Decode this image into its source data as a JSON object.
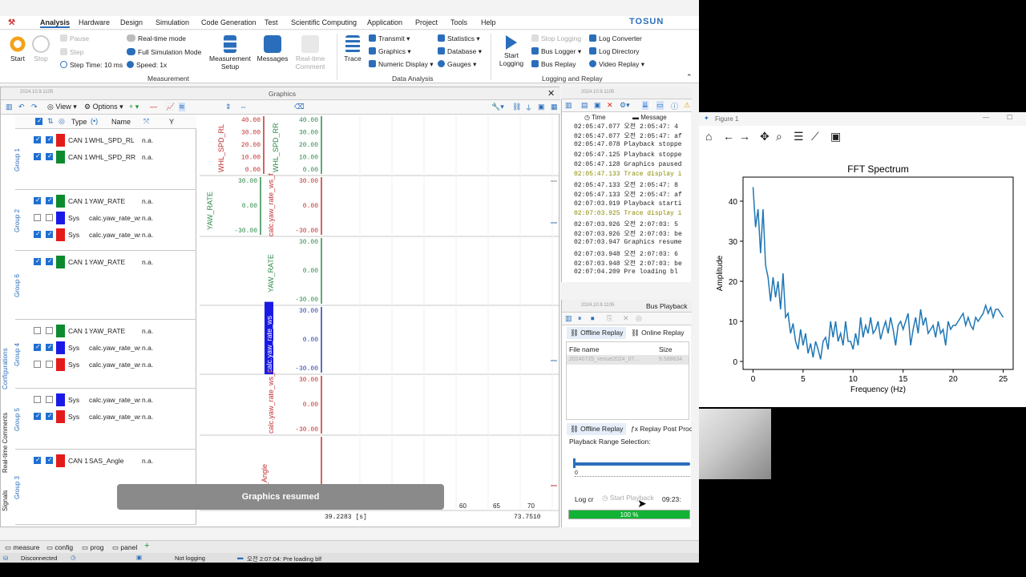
{
  "menubar": {
    "items": [
      "Analysis",
      "Hardware",
      "Design",
      "Simulation",
      "Code Generation",
      "Test",
      "Scientific Computing",
      "Application",
      "Project",
      "Tools",
      "Help"
    ],
    "brand": "TOSUN"
  },
  "ribbon": {
    "start": "Start",
    "stop": "Stop",
    "pause": "Pause",
    "step": "Step",
    "step_time": "Step Time: 10 ms",
    "realtime": "Real-time mode",
    "fullsim": "Full Simulation Mode",
    "speed": "Speed: 1x",
    "meas_setup": "Measurement Setup",
    "messages": "Messages",
    "rt_comment": "Real-time Comment",
    "group_measurement": "Measurement",
    "trace": "Trace",
    "transmit": "Transmit",
    "graphics": "Graphics",
    "numeric": "Numeric Display",
    "statistics": "Statistics",
    "database": "Database",
    "gauges": "Gauges",
    "group_data": "Data Analysis",
    "start_logging": "Start Logging",
    "stop_logging": "Stop Logging",
    "bus_logger": "Bus Logger",
    "bus_replay": "Bus Replay",
    "log_converter": "Log Converter",
    "log_directory": "Log Directory",
    "video_replay": "Video Replay",
    "group_logging": "Logging and Replay"
  },
  "graphics": {
    "title": "Graphics",
    "version": "2024.10.9.1105",
    "view": "View",
    "options": "Options",
    "col_type": "Type",
    "col_name": "Name",
    "col_y": "Y",
    "groups": [
      {
        "label": "Group 1",
        "rows": [
          {
            "type": "CAN 1",
            "name": "WHL_SPD_RL",
            "y": "n.a.",
            "color": "#e31b1b",
            "c1": true,
            "c2": true
          },
          {
            "type": "CAN 1",
            "name": "WHL_SPD_RR",
            "y": "n.a.",
            "color": "#0e8a2e",
            "c1": true,
            "c2": true
          }
        ]
      },
      {
        "label": "Group 2",
        "rows": [
          {
            "type": "CAN 1",
            "name": "YAW_RATE",
            "y": "n.a.",
            "color": "#0e8a2e",
            "c1": true,
            "c2": true
          },
          {
            "type": "Sys",
            "name": "calc.yaw_rate_ws",
            "y": "n.a.",
            "color": "#1a1ae6",
            "c1": false,
            "c2": false
          },
          {
            "type": "Sys",
            "name": "calc.yaw_rate_ws",
            "y": "n.a.",
            "color": "#e31b1b",
            "c1": true,
            "c2": true
          }
        ]
      },
      {
        "label": "Group 6",
        "rows": [
          {
            "type": "CAN 1",
            "name": "YAW_RATE",
            "y": "n.a.",
            "color": "#0e8a2e",
            "c1": true,
            "c2": true
          }
        ]
      },
      {
        "label": "Group 4",
        "rows": [
          {
            "type": "CAN 1",
            "name": "YAW_RATE",
            "y": "n.a.",
            "color": "#0e8a2e",
            "c1": false,
            "c2": false
          },
          {
            "type": "Sys",
            "name": "calc.yaw_rate_ws",
            "y": "n.a.",
            "color": "#1a1ae6",
            "c1": true,
            "c2": true
          },
          {
            "type": "Sys",
            "name": "calc.yaw_rate_ws",
            "y": "n.a.",
            "color": "#e31b1b",
            "c1": false,
            "c2": false
          }
        ]
      },
      {
        "label": "Group 5",
        "rows": [
          {
            "type": "Sys",
            "name": "calc.yaw_rate_ws",
            "y": "n.a.",
            "color": "#1a1ae6",
            "c1": false,
            "c2": false
          },
          {
            "type": "Sys",
            "name": "calc.yaw_rate_ws",
            "y": "n.a.",
            "color": "#e31b1b",
            "c1": true,
            "c2": true
          }
        ]
      },
      {
        "label": "Group 3",
        "rows": [
          {
            "type": "CAN 1",
            "name": "SAS_Angle",
            "y": "n.a.",
            "color": "#e31b1b",
            "c1": true,
            "c2": true
          }
        ]
      }
    ],
    "plot1": {
      "red_ticks": [
        "40.00",
        "30.00",
        "20.00",
        "10.00",
        "0.00"
      ],
      "green_ticks": [
        "40.00",
        "30.00",
        "20.00",
        "10.00",
        "0.00"
      ],
      "red_label": "WHL_SPD_RL",
      "green_label": "WHL_SPD_RR"
    },
    "plot2": {
      "green_ticks": [
        "30.00",
        "0.00",
        "-30.00"
      ],
      "red_ticks": [
        "30.00",
        "0.00",
        "-30.00"
      ],
      "green_label": "YAW_RATE",
      "red_label": "calc.yaw_rate_ws_f"
    },
    "plot6": {
      "ticks": [
        "30.00",
        "0.00",
        "-30.00"
      ],
      "label": "YAW_RATE"
    },
    "plot4": {
      "ticks": [
        "30.00",
        "0.00",
        "-30.00"
      ],
      "label": "calc.yaw_rate_ws"
    },
    "plot5": {
      "ticks": [
        "30.00",
        "0.00",
        "-30.00"
      ],
      "label": "calc.yaw_rate_ws_f"
    },
    "plot3": {
      "label": "S_Angle"
    },
    "xticks": [
      "60",
      "65",
      "70"
    ],
    "cursor_time": "39.2283 [s]",
    "end_time": "73.7510",
    "side_tabs": [
      "Configurations",
      "Real-time Comments",
      "Signals"
    ]
  },
  "toast": "Graphics resumed",
  "bottom_tabs": [
    "measure",
    "config",
    "prog",
    "panel"
  ],
  "status": {
    "conn": "Disconnected",
    "logging": "Not logging",
    "msg": "오전 2:07:04: Pre loading blf"
  },
  "log": {
    "version": "2024.10.9.1105",
    "col_time": "Time",
    "col_msg": "Message",
    "lines": [
      {
        "t": "02:05:47.077",
        "m": "오전 2:05:47: 4",
        "c": "#222"
      },
      {
        "t": "02:05:47.077",
        "m": "오전 2:05:47: af",
        "c": "#222"
      },
      {
        "t": "02:05:47.078",
        "m": "Playback stoppe",
        "c": "#222"
      },
      {
        "t": "02:05:47.125",
        "m": "Playback stoppe",
        "c": "#222"
      },
      {
        "t": "02:05:47.128",
        "m": "Graphics paused",
        "c": "#222"
      },
      {
        "t": "02:05:47.133",
        "m": "Trace display i",
        "c": "#8a8a00"
      },
      {
        "t": "02:05:47.133",
        "m": "오전 2:05:47: 8",
        "c": "#222"
      },
      {
        "t": "02:05:47.133",
        "m": "오전 2:05:47: af",
        "c": "#222"
      },
      {
        "t": "02:07:03.919",
        "m": "Playback starti",
        "c": "#222"
      },
      {
        "t": "02:07:03.925",
        "m": "Trace display i",
        "c": "#8a8a00"
      },
      {
        "t": "02:07:03.926",
        "m": "오전 2:07:03: 5",
        "c": "#222"
      },
      {
        "t": "02:07:03.926",
        "m": "오전 2:07:03: be",
        "c": "#222"
      },
      {
        "t": "02:07:03.947",
        "m": "Graphics resume",
        "c": "#222"
      },
      {
        "t": "02:07:03.948",
        "m": "오전 2:07:03: 6",
        "c": "#222"
      },
      {
        "t": "02:07:03.948",
        "m": "오전 2:07:03: be",
        "c": "#222"
      },
      {
        "t": "02:07:04.209",
        "m": "Pre loading bl",
        "c": "#222"
      }
    ]
  },
  "busplay": {
    "version": "2024.10.9.1105",
    "title": "Bus Playback",
    "tab_offline": "Offline Replay",
    "tab_online": "Online Replay",
    "col_file": "File name",
    "col_size": "Size (MB)",
    "file": "20240725_venue2024_07...",
    "size": "9.588634",
    "tab2_offline": "Offline Replay",
    "tab2_post": "Replay Post Proce",
    "range_label": "Playback Range Selection:",
    "range_start": "0",
    "log_label": "Log cr",
    "start_playback": "Start Playback",
    "time": "09:23:",
    "progress_text": "100 %",
    "progress": 1.0
  },
  "figure": {
    "window_title": "Figure 1"
  },
  "chart_data": {
    "type": "line",
    "title": "FFT Spectrum",
    "xlabel": "Frequency (Hz)",
    "ylabel": "Amplitude",
    "xlim": [
      -1,
      26
    ],
    "ylim": [
      -2,
      46
    ],
    "xticks": [
      0,
      5,
      10,
      15,
      20,
      25
    ],
    "yticks": [
      0,
      10,
      20,
      30,
      40
    ],
    "x": [
      0,
      0.25,
      0.5,
      0.75,
      1,
      1.25,
      1.5,
      1.75,
      2,
      2.25,
      2.5,
      2.75,
      3,
      3.25,
      3.5,
      3.75,
      4,
      4.25,
      4.5,
      4.75,
      5,
      5.25,
      5.5,
      5.75,
      6,
      6.25,
      6.5,
      6.75,
      7,
      7.25,
      7.5,
      7.75,
      8,
      8.25,
      8.5,
      8.75,
      9,
      9.25,
      9.5,
      9.75,
      10,
      10.25,
      10.5,
      10.75,
      11,
      11.25,
      11.5,
      11.75,
      12,
      12.25,
      12.5,
      12.75,
      13,
      13.25,
      13.5,
      13.75,
      14,
      14.25,
      14.5,
      14.75,
      15,
      15.25,
      15.5,
      15.75,
      16,
      16.25,
      16.5,
      16.75,
      17,
      17.25,
      17.5,
      17.75,
      18,
      18.25,
      18.5,
      18.75,
      19,
      19.25,
      19.5,
      19.75,
      20,
      20.25,
      20.5,
      20.75,
      21,
      21.25,
      21.5,
      21.75,
      22,
      22.25,
      22.5,
      22.75,
      23,
      23.25,
      23.5,
      23.75,
      24,
      24.25,
      24.5,
      24.75,
      25
    ],
    "series": [
      {
        "values": [
          43.5,
          33.5,
          38,
          27,
          38,
          24,
          21,
          15,
          21,
          16,
          20,
          13,
          22,
          11,
          12,
          7,
          9.5,
          5,
          3,
          8,
          4,
          7,
          2,
          4.5,
          1,
          5,
          3,
          0.5,
          5,
          6,
          3,
          10,
          6,
          10,
          5,
          7,
          4,
          10,
          5,
          5,
          3,
          7,
          4,
          11,
          6,
          9,
          7,
          11,
          7,
          8,
          10,
          5.5,
          8,
          10,
          7,
          11,
          8,
          4,
          9,
          10,
          8,
          10,
          12,
          4,
          8,
          11,
          7,
          13,
          9,
          11,
          7,
          8,
          9,
          6,
          10,
          7,
          8,
          4,
          10,
          8,
          9,
          9,
          10,
          11,
          12,
          9,
          11,
          9,
          8,
          11,
          10,
          11,
          12,
          14,
          12,
          13.5,
          11,
          13,
          13,
          12,
          11,
          13,
          10.5
        ]
      }
    ]
  }
}
